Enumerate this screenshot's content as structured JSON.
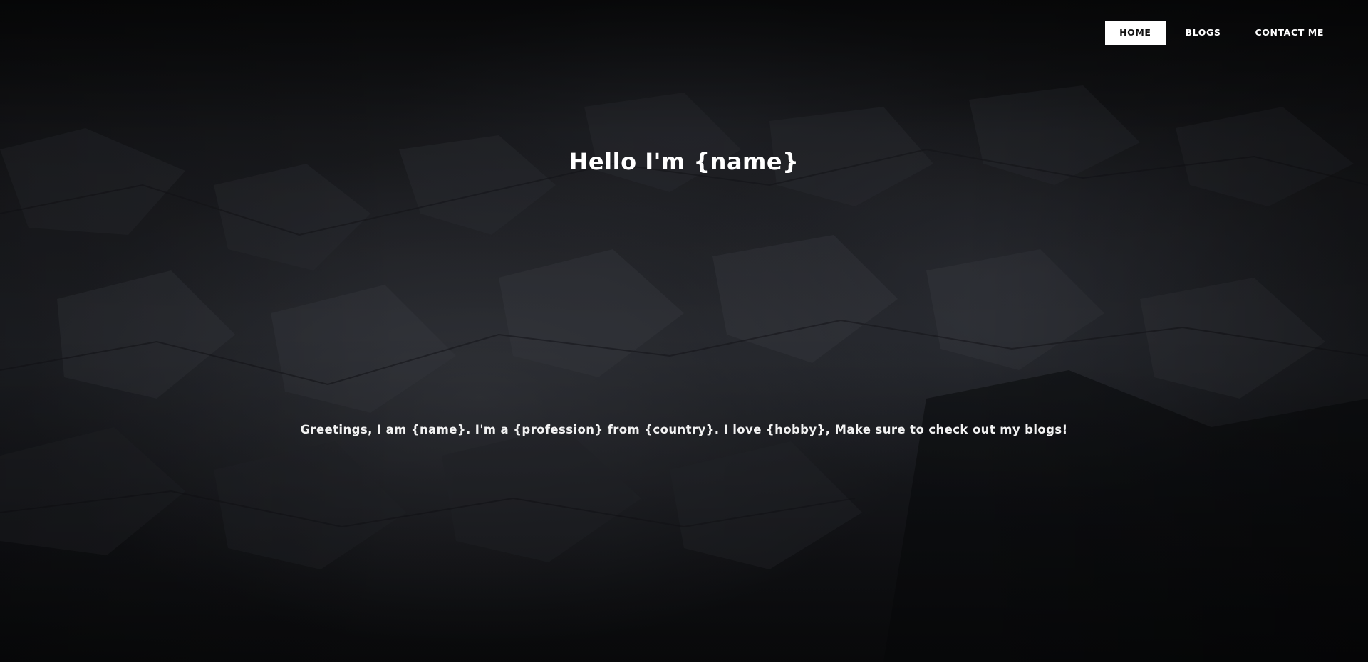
{
  "nav": {
    "items": [
      {
        "label": "HOME",
        "active": true
      },
      {
        "label": "BLOGS",
        "active": false
      },
      {
        "label": "CONTACT ME",
        "active": false
      }
    ]
  },
  "hero": {
    "title": "Hello I'm {name}",
    "text": "Greetings, I am {name}. I'm a {profession} from {country}. I love {hobby}, Make sure to check out my blogs!",
    "background": "dark-rock-photo"
  },
  "colors": {
    "text": "#ffffff",
    "active_nav_bg": "#ffffff",
    "active_nav_text": "#111111",
    "background": "#0b0c0e"
  }
}
